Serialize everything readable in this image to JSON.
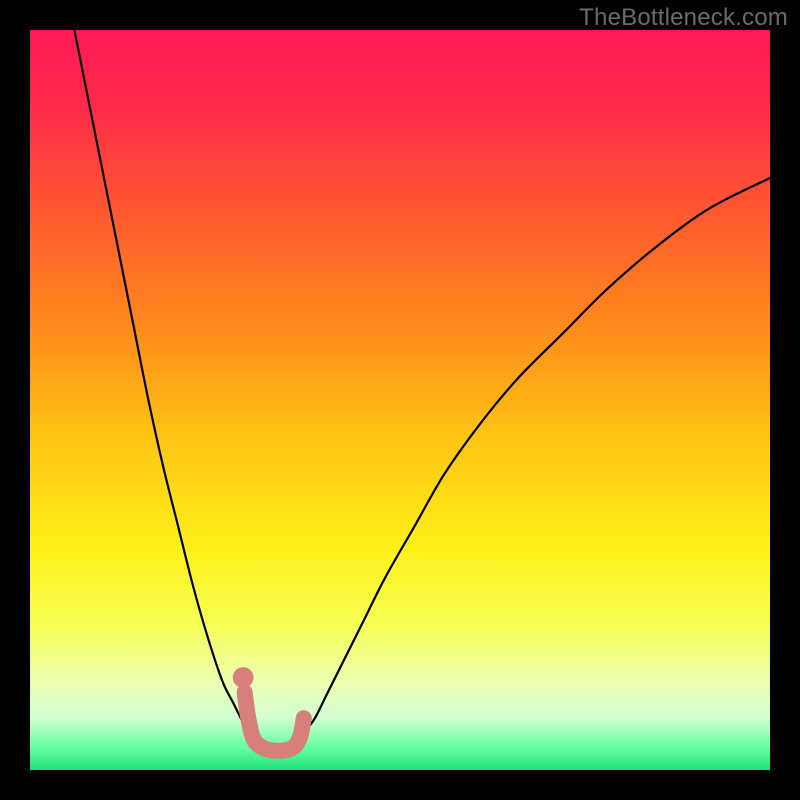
{
  "watermark": "TheBottleneck.com",
  "chart_data": {
    "type": "line",
    "title": "",
    "xlabel": "",
    "ylabel": "",
    "xlim": [
      0,
      100
    ],
    "ylim": [
      0,
      100
    ],
    "grid": false,
    "legend": false,
    "background_gradient": [
      {
        "pos": 0.0,
        "color": "#ff1a55"
      },
      {
        "pos": 0.1,
        "color": "#ff2a4a"
      },
      {
        "pos": 0.25,
        "color": "#ff5a2f"
      },
      {
        "pos": 0.4,
        "color": "#ff8a1c"
      },
      {
        "pos": 0.55,
        "color": "#ffc413"
      },
      {
        "pos": 0.7,
        "color": "#fff019"
      },
      {
        "pos": 0.8,
        "color": "#f7ff52"
      },
      {
        "pos": 0.88,
        "color": "#ecffb0"
      },
      {
        "pos": 0.93,
        "color": "#d2ffd2"
      },
      {
        "pos": 0.97,
        "color": "#63ff9f"
      },
      {
        "pos": 1.0,
        "color": "#1fe27a"
      }
    ],
    "series": [
      {
        "name": "curve-left",
        "x": [
          6,
          8,
          10,
          12,
          14,
          16,
          18,
          20,
          22,
          24,
          26,
          27.5,
          29,
          30,
          31
        ],
        "y": [
          100,
          90,
          80,
          70,
          60,
          50,
          41,
          33,
          25,
          18,
          12,
          9,
          6,
          4.5,
          3.5
        ]
      },
      {
        "name": "curve-right",
        "x": [
          36,
          37,
          38.5,
          40,
          42,
          45,
          48,
          52,
          56,
          61,
          66,
          72,
          78,
          85,
          92,
          100
        ],
        "y": [
          3.5,
          5,
          7,
          10,
          14,
          20,
          26,
          33,
          40,
          47,
          53,
          59,
          65,
          71,
          76,
          80
        ]
      },
      {
        "name": "marker-blob",
        "stroke": "#d77f7b",
        "stroke_width": 16,
        "linecap": "round",
        "points": [
          {
            "x": 29.0,
            "y": 10.5
          },
          {
            "x": 29.5,
            "y": 7.0
          },
          {
            "x": 30.2,
            "y": 4.2
          },
          {
            "x": 31.5,
            "y": 3.0
          },
          {
            "x": 33.5,
            "y": 2.6
          },
          {
            "x": 35.5,
            "y": 3.0
          },
          {
            "x": 36.5,
            "y": 4.5
          },
          {
            "x": 37.0,
            "y": 7.0
          }
        ]
      },
      {
        "name": "marker-dot",
        "fill": "#d77f7b",
        "cx": 28.8,
        "cy": 12.5,
        "r": 1.4
      }
    ]
  }
}
